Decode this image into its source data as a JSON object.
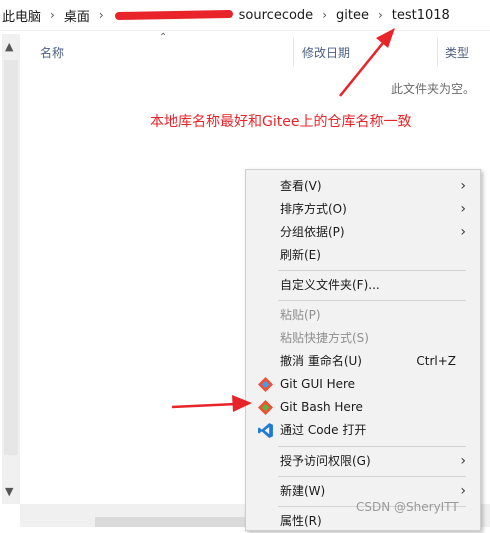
{
  "breadcrumb": {
    "items": [
      "此电脑",
      "桌面",
      "sourcecode",
      "gitee",
      "test1018"
    ],
    "separator": "›"
  },
  "columns": {
    "name": "名称",
    "date": "修改日期",
    "type": "类型"
  },
  "empty_message": "此文件夹为空。",
  "annotation": "本地库名称最好和Gitee上的仓库名称一致",
  "menu": {
    "view": "查看(V)",
    "sort": "排序方式(O)",
    "group": "分组依据(P)",
    "refresh": "刷新(E)",
    "customize": "自定义文件夹(F)...",
    "paste": "粘贴(P)",
    "paste_shortcut": "粘贴快捷方式(S)",
    "undo": "撤消 重命名(U)",
    "undo_shortcut": "Ctrl+Z",
    "git_gui": "Git GUI Here",
    "git_bash": "Git Bash Here",
    "vscode": "通过 Code 打开",
    "grant_access": "授予访问权限(G)",
    "new": "新建(W)",
    "properties": "属性(R)"
  },
  "watermark": "CSDN @SheryITT",
  "colors": {
    "annotation": "#e8242a",
    "vscode": "#1f7ad1",
    "git": "#f05033"
  },
  "icons": [
    "chevron-right-icon",
    "git-icon",
    "vscode-icon",
    "sort-caret-icon"
  ]
}
